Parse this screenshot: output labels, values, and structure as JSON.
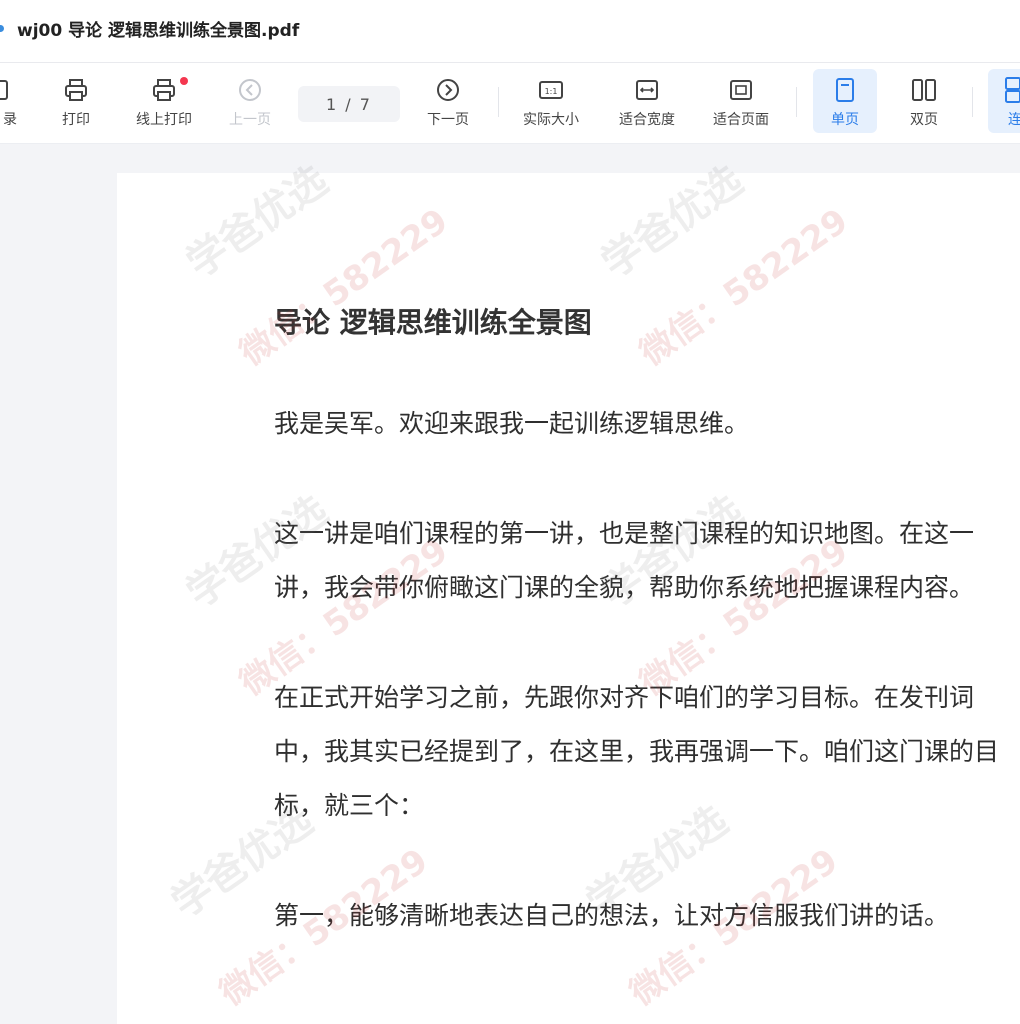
{
  "window": {
    "title": "wj00 导论 逻辑思维训练全景图.pdf"
  },
  "toolbar": {
    "catalog": "目录",
    "catalog_partial": "录",
    "print": "打印",
    "online_print": "线上打印",
    "prev_page": "上一页",
    "page_indicator": "1 / 7",
    "next_page": "下一页",
    "actual_size": "实际大小",
    "fit_width": "适合宽度",
    "fit_page": "适合页面",
    "single_page": "单页",
    "double_page": "双页",
    "continuous_partial": "连续"
  },
  "document": {
    "heading": "导论  逻辑思维训练全景图",
    "paragraphs": [
      "我是吴军。欢迎来跟我一起训练逻辑思维。",
      "这一讲是咱们课程的第一讲，也是整门课程的知识地图。在这一讲，我会带你俯瞰这门课的全貌，帮助你系统地把握课程内容。",
      "在正式开始学习之前，先跟你对齐下咱们的学习目标。在发刊词中，我其实已经提到了，在这里，我再强调一下。咱们这门课的目标，就三个：",
      "第一，能够清晰地表达自己的想法，让对方信服我们讲的话。"
    ]
  },
  "watermark": {
    "brand": "学爸优选",
    "contact": "微信：582229"
  },
  "colors": {
    "accent": "#2b7de9",
    "active_bg": "#e6f0fd",
    "badge": "#f4374f"
  },
  "icons": [
    "catalog-icon",
    "printer-icon",
    "online-print-icon",
    "prev-circle-icon",
    "next-circle-icon",
    "actual-size-icon",
    "fit-width-icon",
    "fit-page-icon",
    "single-page-icon",
    "double-page-icon",
    "continuous-icon"
  ]
}
